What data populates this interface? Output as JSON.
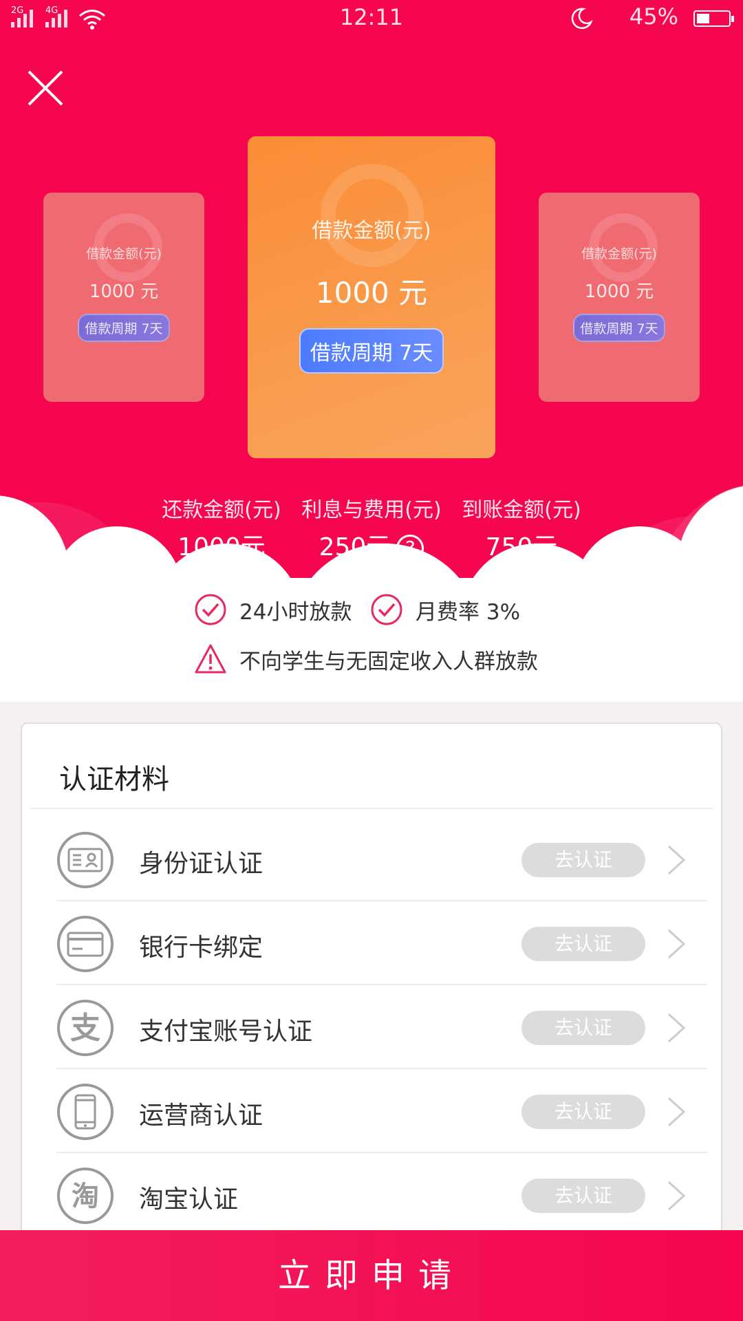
{
  "status_bar": {
    "network_1": "2G",
    "network_2": "4G",
    "time": "12:11",
    "battery": "45%"
  },
  "loan_cards": [
    {
      "label": "借款金额(元)",
      "amount": "1000 元",
      "period": "借款周期 7天"
    },
    {
      "label": "借款金额(元)",
      "amount": "1000 元",
      "period": "借款周期 7天"
    },
    {
      "label": "借款金额(元)",
      "amount": "1000 元",
      "period": "借款周期 7天"
    }
  ],
  "summary": [
    {
      "title": "还款金额(元)",
      "value": "1000元"
    },
    {
      "title": "利息与费用(元)",
      "value": "250元"
    },
    {
      "title": "到账金额(元)",
      "value": "750元"
    }
  ],
  "help_icon_glyph": "?",
  "features": {
    "fast_payout": "24小时放款",
    "monthly_rate": "月费率 3%",
    "warning": "不向学生与无固定收入人群放款"
  },
  "verification": {
    "title": "认证材料",
    "items": [
      {
        "label": "身份证认证",
        "button": "去认证",
        "icon": "id-card-icon"
      },
      {
        "label": "银行卡绑定",
        "button": "去认证",
        "icon": "bank-card-icon"
      },
      {
        "label": "支付宝账号认证",
        "button": "去认证",
        "icon": "alipay-icon",
        "glyph": "支"
      },
      {
        "label": "运营商认证",
        "button": "去认证",
        "icon": "phone-icon"
      },
      {
        "label": "淘宝认证",
        "button": "去认证",
        "icon": "taobao-icon",
        "glyph": "淘"
      }
    ]
  },
  "apply_button": "立即申请",
  "colors": {
    "brand": "#f5064f",
    "card_orange": "#fb8c36",
    "pill_blue": "#4d7bff"
  }
}
